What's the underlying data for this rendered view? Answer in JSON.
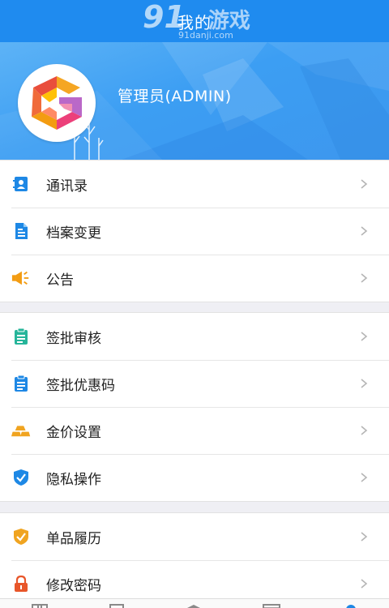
{
  "header": {
    "title": "我的",
    "watermark": {
      "number": "91",
      "text": "游戏",
      "url": "91danji.com"
    }
  },
  "profile": {
    "username": "管理员(ADMIN)",
    "avatar_icon": "g-logo-icon"
  },
  "menu_groups": [
    {
      "items": [
        {
          "label": "通讯录",
          "icon": "contacts-icon",
          "color": "#1e88e5"
        },
        {
          "label": "档案变更",
          "icon": "file-document-icon",
          "color": "#1e88e5"
        },
        {
          "label": "公告",
          "icon": "megaphone-icon",
          "color": "#f39c12"
        }
      ]
    },
    {
      "items": [
        {
          "label": "签批审核",
          "icon": "clipboard-icon",
          "color": "#26b59a"
        },
        {
          "label": "签批优惠码",
          "icon": "clipboard-icon",
          "color": "#1e88e5"
        },
        {
          "label": "金价设置",
          "icon": "gold-bars-icon",
          "color": "#f0a420"
        },
        {
          "label": "隐私操作",
          "icon": "shield-check-icon",
          "color": "#1e88e5"
        }
      ]
    },
    {
      "items": [
        {
          "label": "单品履历",
          "icon": "shield-check-icon",
          "color": "#f0a420"
        },
        {
          "label": "修改密码",
          "icon": "lock-icon",
          "color": "#e8562a"
        }
      ]
    }
  ],
  "tab_bar": {
    "tabs": [
      {
        "icon": "home-icon"
      },
      {
        "icon": "list-icon"
      },
      {
        "icon": "graduation-icon"
      },
      {
        "icon": "image-icon"
      },
      {
        "icon": "user-icon",
        "active": true
      }
    ],
    "active_color": "#1e88e5"
  }
}
